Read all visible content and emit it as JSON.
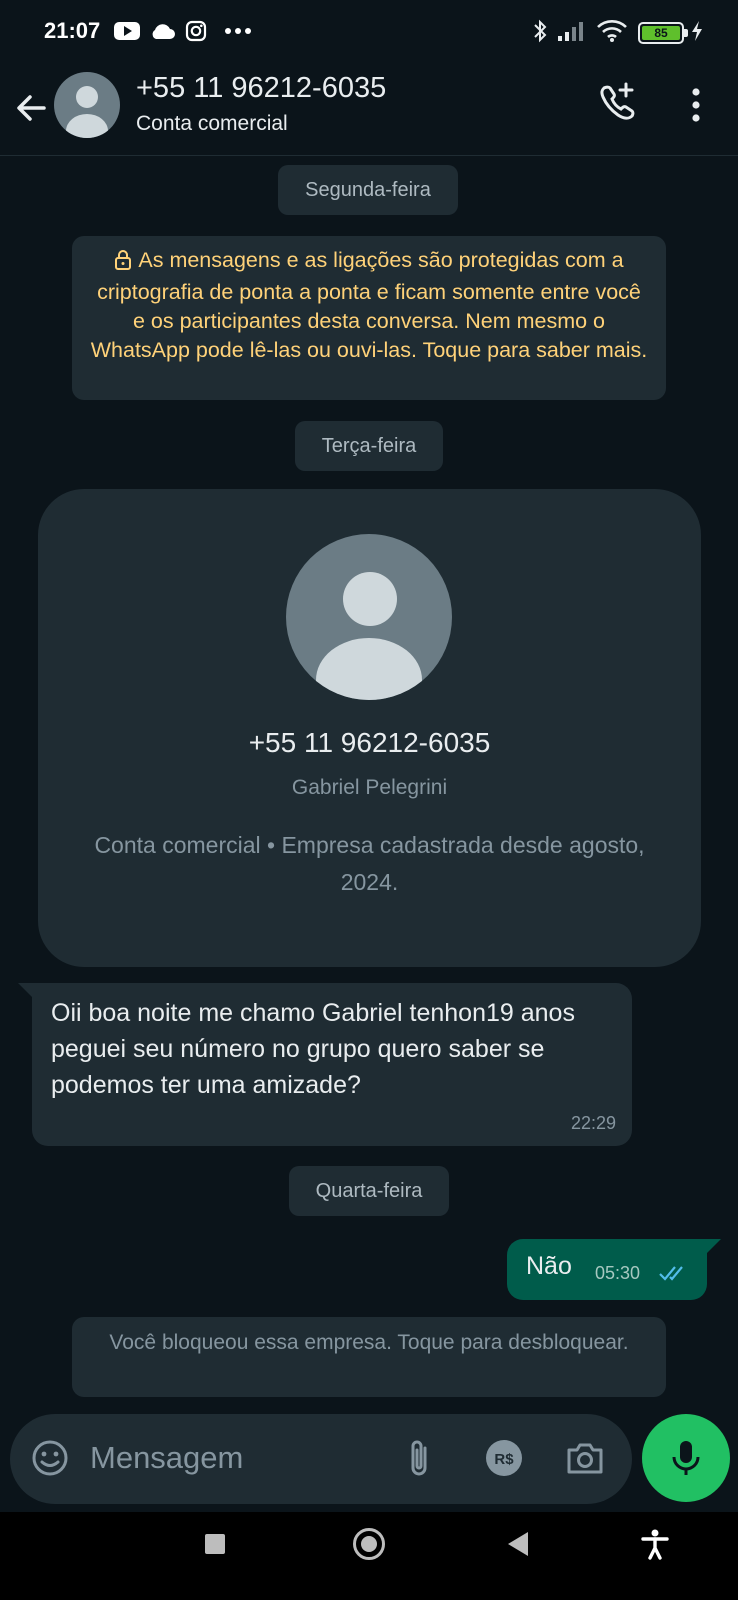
{
  "status_bar": {
    "time": "21:07",
    "battery_level": "85",
    "icons": [
      "youtube-icon",
      "cloud-icon",
      "instagram-icon",
      "more-dots-icon",
      "bluetooth-icon",
      "signal-icon",
      "wifi-icon",
      "battery-icon",
      "charging-icon"
    ]
  },
  "header": {
    "contact_name": "+55 11 96212-6035",
    "subtitle": "Conta comercial"
  },
  "chat": {
    "date_monday": "Segunda-feira",
    "encryption_notice": "As mensagens e as ligações são protegidas com a criptografia de ponta a ponta e ficam somente entre você e os participantes desta conversa. Nem mesmo o WhatsApp pode lê-las ou ouvi-las. Toque para saber mais.",
    "date_tuesday": "Terça-feira",
    "business_card": {
      "phone": "+55 11 96212-6035",
      "name": "Gabriel Pelegrini",
      "info": "Conta comercial • Empresa cadastrada desde agosto, 2024."
    },
    "incoming": {
      "text": "Oii boa noite me chamo Gabriel tenhon19 anos peguei seu número no grupo quero saber se podemos ter uma amizade?",
      "time": "22:29"
    },
    "date_wednesday": "Quarta-feira",
    "outgoing": {
      "text": "Não",
      "time": "05:30",
      "status": "read"
    },
    "blocked_notice": "Você bloqueou essa empresa. Toque para desbloquear."
  },
  "composer": {
    "placeholder": "Mensagem"
  },
  "colors": {
    "background": "#0b141a",
    "bubble_in": "#1f2c33",
    "bubble_out": "#005c4b",
    "accent": "#21c063",
    "notice_text": "#ffd279",
    "read_ticks": "#53bdeb"
  }
}
